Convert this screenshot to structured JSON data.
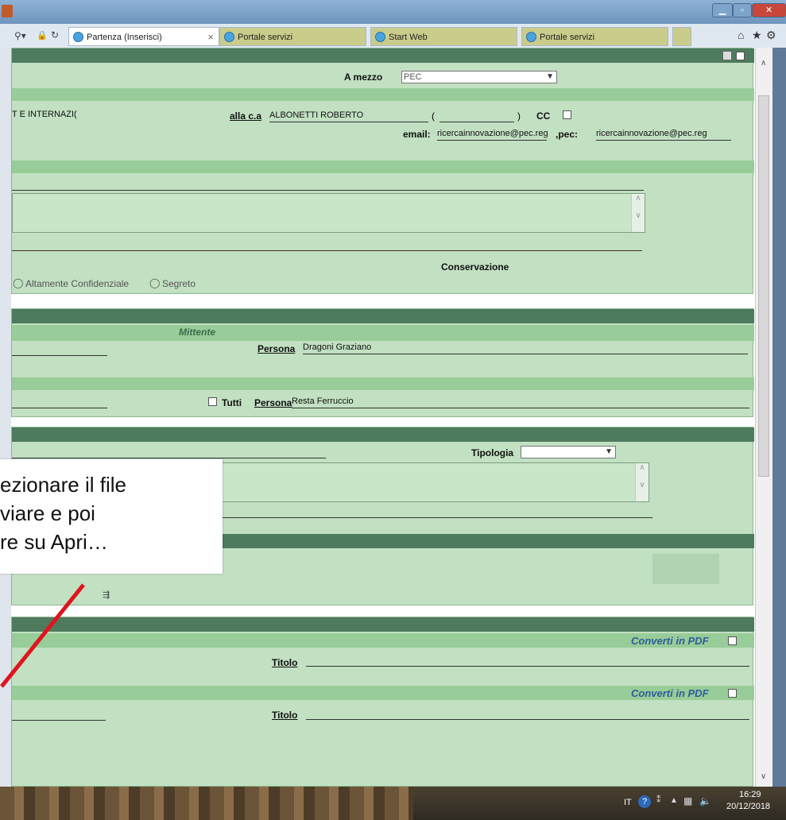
{
  "browser": {
    "tabs": [
      {
        "label": "Partenza (Inserisci)",
        "active": true
      },
      {
        "label": "Portale servizi",
        "active": false
      },
      {
        "label": "Start Web",
        "active": false
      },
      {
        "label": "Portale servizi",
        "active": false
      }
    ],
    "nav_icons": [
      "search-icon",
      "lock-icon",
      "refresh-icon"
    ],
    "right_icons": [
      "home-icon",
      "star-icon",
      "gear-icon"
    ],
    "close_tab": "×"
  },
  "form": {
    "a_mezzo_label": "A mezzo",
    "a_mezzo_value": "PEC",
    "destinatario_partial": "T E INTERNAZI(",
    "alla_ca_label": "alla c.a",
    "alla_ca_value": "ALBONETTI ROBERTO",
    "paren_open": "(",
    "paren_close": ")",
    "cc_label": "CC",
    "email_label": "email:",
    "email_value": "ricercainnovazione@pec.reg",
    "pec_label": ",pec:",
    "pec_value": "ricercainnovazione@pec.reg",
    "conservazione_label": "Conservazione",
    "riservatezza_text": "Altamente Confidenziale",
    "segreto_text": "Segreto",
    "mittente_label": "Mittente",
    "persona_label": "Persona",
    "persona_mittente": "Dragoni Graziano",
    "tutti_label": "Tutti",
    "persona_assegn": "Resta Ferruccio",
    "tipologia_label": "Tipologia",
    "converti_label": "Converti in PDF",
    "titolo_label": "Titolo"
  },
  "callout": {
    "lines": [
      "ezionare il file",
      "viare e poi",
      "re su Apri…"
    ]
  },
  "taskbar": {
    "lang": "IT",
    "time": "16:29",
    "date": "20/12/2018"
  },
  "colors": {
    "section_bg": "#c2e0c2",
    "header_dark": "#4e7a5e",
    "sub_header": "#98cc98",
    "arrow_red": "#e0141e",
    "italic_blue": "#2d5e9c"
  }
}
